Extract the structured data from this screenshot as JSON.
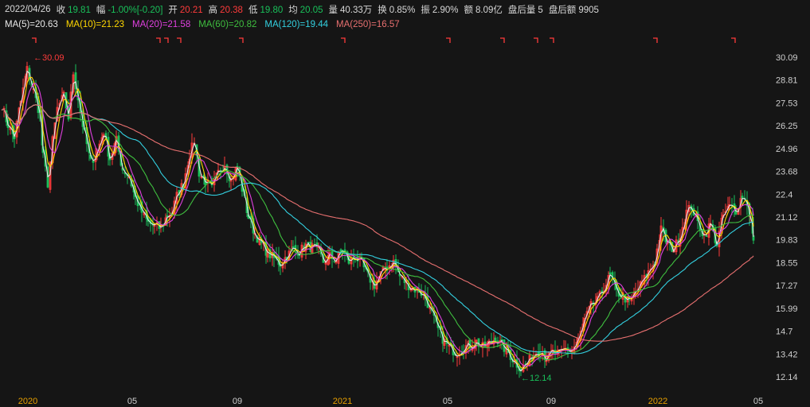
{
  "header": {
    "date": "2022/04/26",
    "close_label": "收",
    "close_value": "19.81",
    "change_label": "幅",
    "change_value": "-1.00%[-0.20]",
    "open_label": "开",
    "open_value": "20.21",
    "high_label": "高",
    "high_value": "20.38",
    "low_label": "低",
    "low_value": "19.80",
    "avg_label": "均",
    "avg_value": "20.05",
    "volume_label": "量",
    "volume_value": "40.33万",
    "turnover_label": "换",
    "turnover_value": "0.85%",
    "amplitude_label": "振",
    "amplitude_value": "2.90%",
    "amount_label": "额",
    "amount_value": "8.09亿",
    "after_vol_label": "盘后量",
    "after_vol_value": "5",
    "after_amt_label": "盘后额",
    "after_amt_value": "9905"
  },
  "ma_legend": [
    {
      "text": "MA(5)=20.63",
      "color": "#e8e8e8"
    },
    {
      "text": "MA(10)=21.23",
      "color": "#ffd800"
    },
    {
      "text": "MA(20)=21.58",
      "color": "#e040e0"
    },
    {
      "text": "MA(60)=20.82",
      "color": "#3fbf3f"
    },
    {
      "text": "MA(120)=19.44",
      "color": "#33d0e0"
    },
    {
      "text": "MA(250)=16.57",
      "color": "#e87070"
    }
  ],
  "chart_data": {
    "type": "candlestick",
    "y_ticks": [
      "30.09",
      "28.81",
      "27.53",
      "26.25",
      "24.96",
      "23.68",
      "22.4",
      "21.12",
      "19.83",
      "18.55",
      "17.27",
      "15.99",
      "14.7",
      "13.42",
      "12.14"
    ],
    "ylim": [
      12.14,
      30.09
    ],
    "x_labels": [
      "2020",
      "05",
      "09",
      "2021",
      "05",
      "09",
      "2022",
      "05"
    ],
    "x_label_years": [
      "2020",
      "2021",
      "2022"
    ],
    "annotations": [
      {
        "text": "30.09",
        "type": "max"
      },
      {
        "text": "12.14",
        "type": "min"
      }
    ],
    "colors": {
      "up": "#ff3b3b",
      "down": "#19c05a",
      "ma5": "#e8e8e8",
      "ma10": "#ffd800",
      "ma20": "#e040e0",
      "ma60": "#3fbf3f",
      "ma120": "#33d0e0",
      "ma250": "#e87070"
    },
    "price_path_nodes": [
      [
        0,
        27.4
      ],
      [
        8,
        26.3
      ],
      [
        16,
        25.6
      ],
      [
        24,
        27.6
      ],
      [
        32,
        29.4
      ],
      [
        40,
        28.2
      ],
      [
        48,
        26.9
      ],
      [
        52,
        24.6
      ],
      [
        58,
        23.0
      ],
      [
        64,
        25.4
      ],
      [
        70,
        27.2
      ],
      [
        78,
        27.9
      ],
      [
        84,
        26.7
      ],
      [
        90,
        29.2
      ],
      [
        96,
        27.8
      ],
      [
        104,
        25.8
      ],
      [
        112,
        24.2
      ],
      [
        120,
        24.8
      ],
      [
        128,
        25.9
      ],
      [
        136,
        24.4
      ],
      [
        144,
        25.4
      ],
      [
        152,
        23.8
      ],
      [
        160,
        23.4
      ],
      [
        168,
        22.2
      ],
      [
        176,
        21.4
      ],
      [
        184,
        20.8
      ],
      [
        192,
        20.6
      ],
      [
        200,
        20.5
      ],
      [
        208,
        21.2
      ],
      [
        214,
        21.4
      ],
      [
        220,
        22.3
      ],
      [
        228,
        23.0
      ],
      [
        236,
        24.6
      ],
      [
        242,
        25.4
      ],
      [
        248,
        23.6
      ],
      [
        256,
        23.1
      ],
      [
        264,
        22.7
      ],
      [
        272,
        23.6
      ],
      [
        280,
        24.1
      ],
      [
        288,
        23.2
      ],
      [
        296,
        23.9
      ],
      [
        302,
        22.7
      ],
      [
        310,
        21.1
      ],
      [
        318,
        20.2
      ],
      [
        326,
        19.6
      ],
      [
        334,
        19.1
      ],
      [
        342,
        18.8
      ],
      [
        350,
        18.5
      ],
      [
        358,
        18.9
      ],
      [
        366,
        19.3
      ],
      [
        374,
        19.2
      ],
      [
        382,
        19.5
      ],
      [
        390,
        19.4
      ],
      [
        398,
        19.2
      ],
      [
        404,
        18.6
      ],
      [
        412,
        18.9
      ],
      [
        420,
        18.7
      ],
      [
        428,
        19.3
      ],
      [
        436,
        18.6
      ],
      [
        444,
        18.9
      ],
      [
        452,
        18.5
      ],
      [
        460,
        17.8
      ],
      [
        468,
        17.3
      ],
      [
        476,
        17.9
      ],
      [
        484,
        18.3
      ],
      [
        492,
        18.6
      ],
      [
        500,
        17.8
      ],
      [
        508,
        17.4
      ],
      [
        516,
        17.1
      ],
      [
        524,
        17.0
      ],
      [
        532,
        16.6
      ],
      [
        540,
        15.7
      ],
      [
        548,
        14.8
      ],
      [
        556,
        14.1
      ],
      [
        564,
        13.7
      ],
      [
        572,
        13.5
      ],
      [
        580,
        13.8
      ],
      [
        588,
        13.9
      ],
      [
        596,
        14.1
      ],
      [
        604,
        13.8
      ],
      [
        612,
        14.0
      ],
      [
        620,
        14.3
      ],
      [
        628,
        13.9
      ],
      [
        636,
        13.5
      ],
      [
        644,
        13.0
      ],
      [
        652,
        12.6
      ],
      [
        660,
        12.9
      ],
      [
        668,
        13.4
      ],
      [
        676,
        13.7
      ],
      [
        684,
        13.2
      ],
      [
        692,
        13.5
      ],
      [
        700,
        13.4
      ],
      [
        708,
        13.7
      ],
      [
        716,
        13.6
      ],
      [
        724,
        14.2
      ],
      [
        732,
        15.3
      ],
      [
        740,
        16.1
      ],
      [
        748,
        16.4
      ],
      [
        756,
        17.1
      ],
      [
        764,
        17.8
      ],
      [
        772,
        16.9
      ],
      [
        780,
        16.7
      ],
      [
        788,
        16.3
      ],
      [
        796,
        16.9
      ],
      [
        804,
        17.4
      ],
      [
        812,
        18.0
      ],
      [
        820,
        18.6
      ],
      [
        828,
        20.4
      ],
      [
        836,
        19.6
      ],
      [
        844,
        19.3
      ],
      [
        852,
        20.1
      ],
      [
        860,
        21.4
      ],
      [
        866,
        21.7
      ],
      [
        874,
        20.8
      ],
      [
        882,
        20.1
      ],
      [
        890,
        20.7
      ],
      [
        898,
        19.6
      ],
      [
        906,
        21.2
      ],
      [
        914,
        21.7
      ],
      [
        922,
        21.5
      ],
      [
        930,
        22.3
      ],
      [
        936,
        21.9
      ],
      [
        940,
        21.1
      ],
      [
        944,
        19.81
      ]
    ],
    "signal_marks_x": [
      40,
      196,
      206,
      222,
      300,
      428,
      560,
      628,
      670,
      690,
      820,
      918
    ]
  }
}
